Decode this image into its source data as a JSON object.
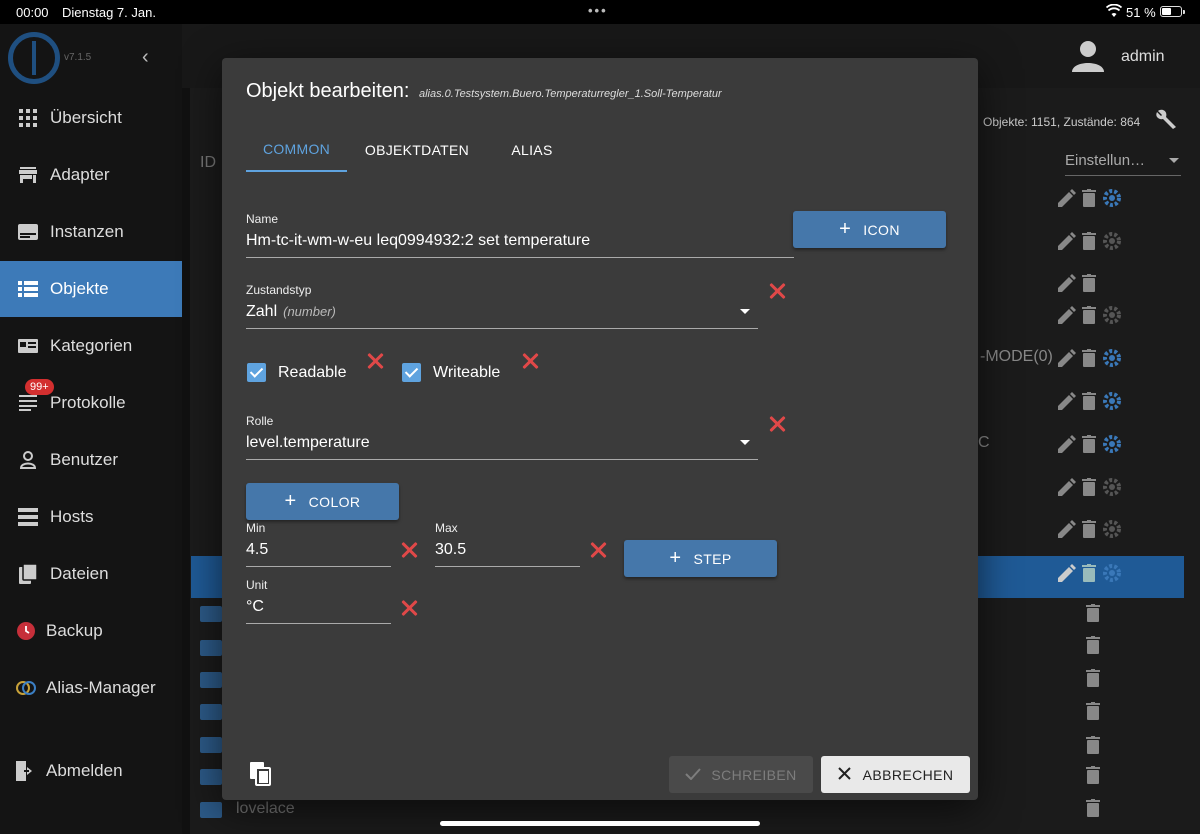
{
  "status": {
    "time": "00:00",
    "date": "Dienstag 7. Jan.",
    "battery": "51 %"
  },
  "sidebar": {
    "version": "v7.1.5",
    "items": [
      {
        "label": "Übersicht",
        "icon": "grid-icon"
      },
      {
        "label": "Adapter",
        "icon": "store-icon"
      },
      {
        "label": "Instanzen",
        "icon": "instances-icon"
      },
      {
        "label": "Objekte",
        "icon": "list-icon",
        "active": true
      },
      {
        "label": "Kategorien",
        "icon": "categories-icon"
      },
      {
        "label": "Protokolle",
        "icon": "log-icon",
        "badge": "99+"
      },
      {
        "label": "Benutzer",
        "icon": "user-icon"
      },
      {
        "label": "Hosts",
        "icon": "hosts-icon"
      },
      {
        "label": "Dateien",
        "icon": "files-icon"
      },
      {
        "label": "Backup",
        "icon": "backup-icon"
      },
      {
        "label": "Alias-Manager",
        "icon": "alias-icon"
      },
      {
        "label": "Abmelden",
        "icon": "logout-icon"
      }
    ]
  },
  "header": {
    "user": "admin"
  },
  "objects_bar": {
    "stats": "Objekte: 1151, Zustände: 864",
    "settings": "Einstellun…",
    "id_col": "ID"
  },
  "background": {
    "mode_text": "-MODE(0)",
    "c_text": "C",
    "lovelace": "lovelace"
  },
  "dialog": {
    "title": "Objekt bearbeiten:",
    "path": "alias.0.Testsystem.Buero.Temperaturregler_1.Soll-Temperatur",
    "tabs": [
      "COMMON",
      "OBJEKTDATEN",
      "ALIAS"
    ],
    "name_label": "Name",
    "name_value": "Hm-tc-it-wm-w-eu leq0994932:2 set temperature",
    "icon_button": "ICON",
    "type_label": "Zustandstyp",
    "type_value": "Zahl",
    "type_hint": "(number)",
    "readable": "Readable",
    "writeable": "Writeable",
    "role_label": "Rolle",
    "role_value": "level.temperature",
    "color_button": "COLOR",
    "min_label": "Min",
    "min_value": "4.5",
    "max_label": "Max",
    "max_value": "30.5",
    "step_button": "STEP",
    "unit_label": "Unit",
    "unit_value": "°C",
    "write_button": "SCHREIBEN",
    "cancel_button": "ABBRECHEN"
  },
  "colors": {
    "accent": "#5fa3df",
    "primary_button": "#4577aa",
    "delete_x": "#e04848",
    "sidebar_active": "#3d7ab8"
  }
}
